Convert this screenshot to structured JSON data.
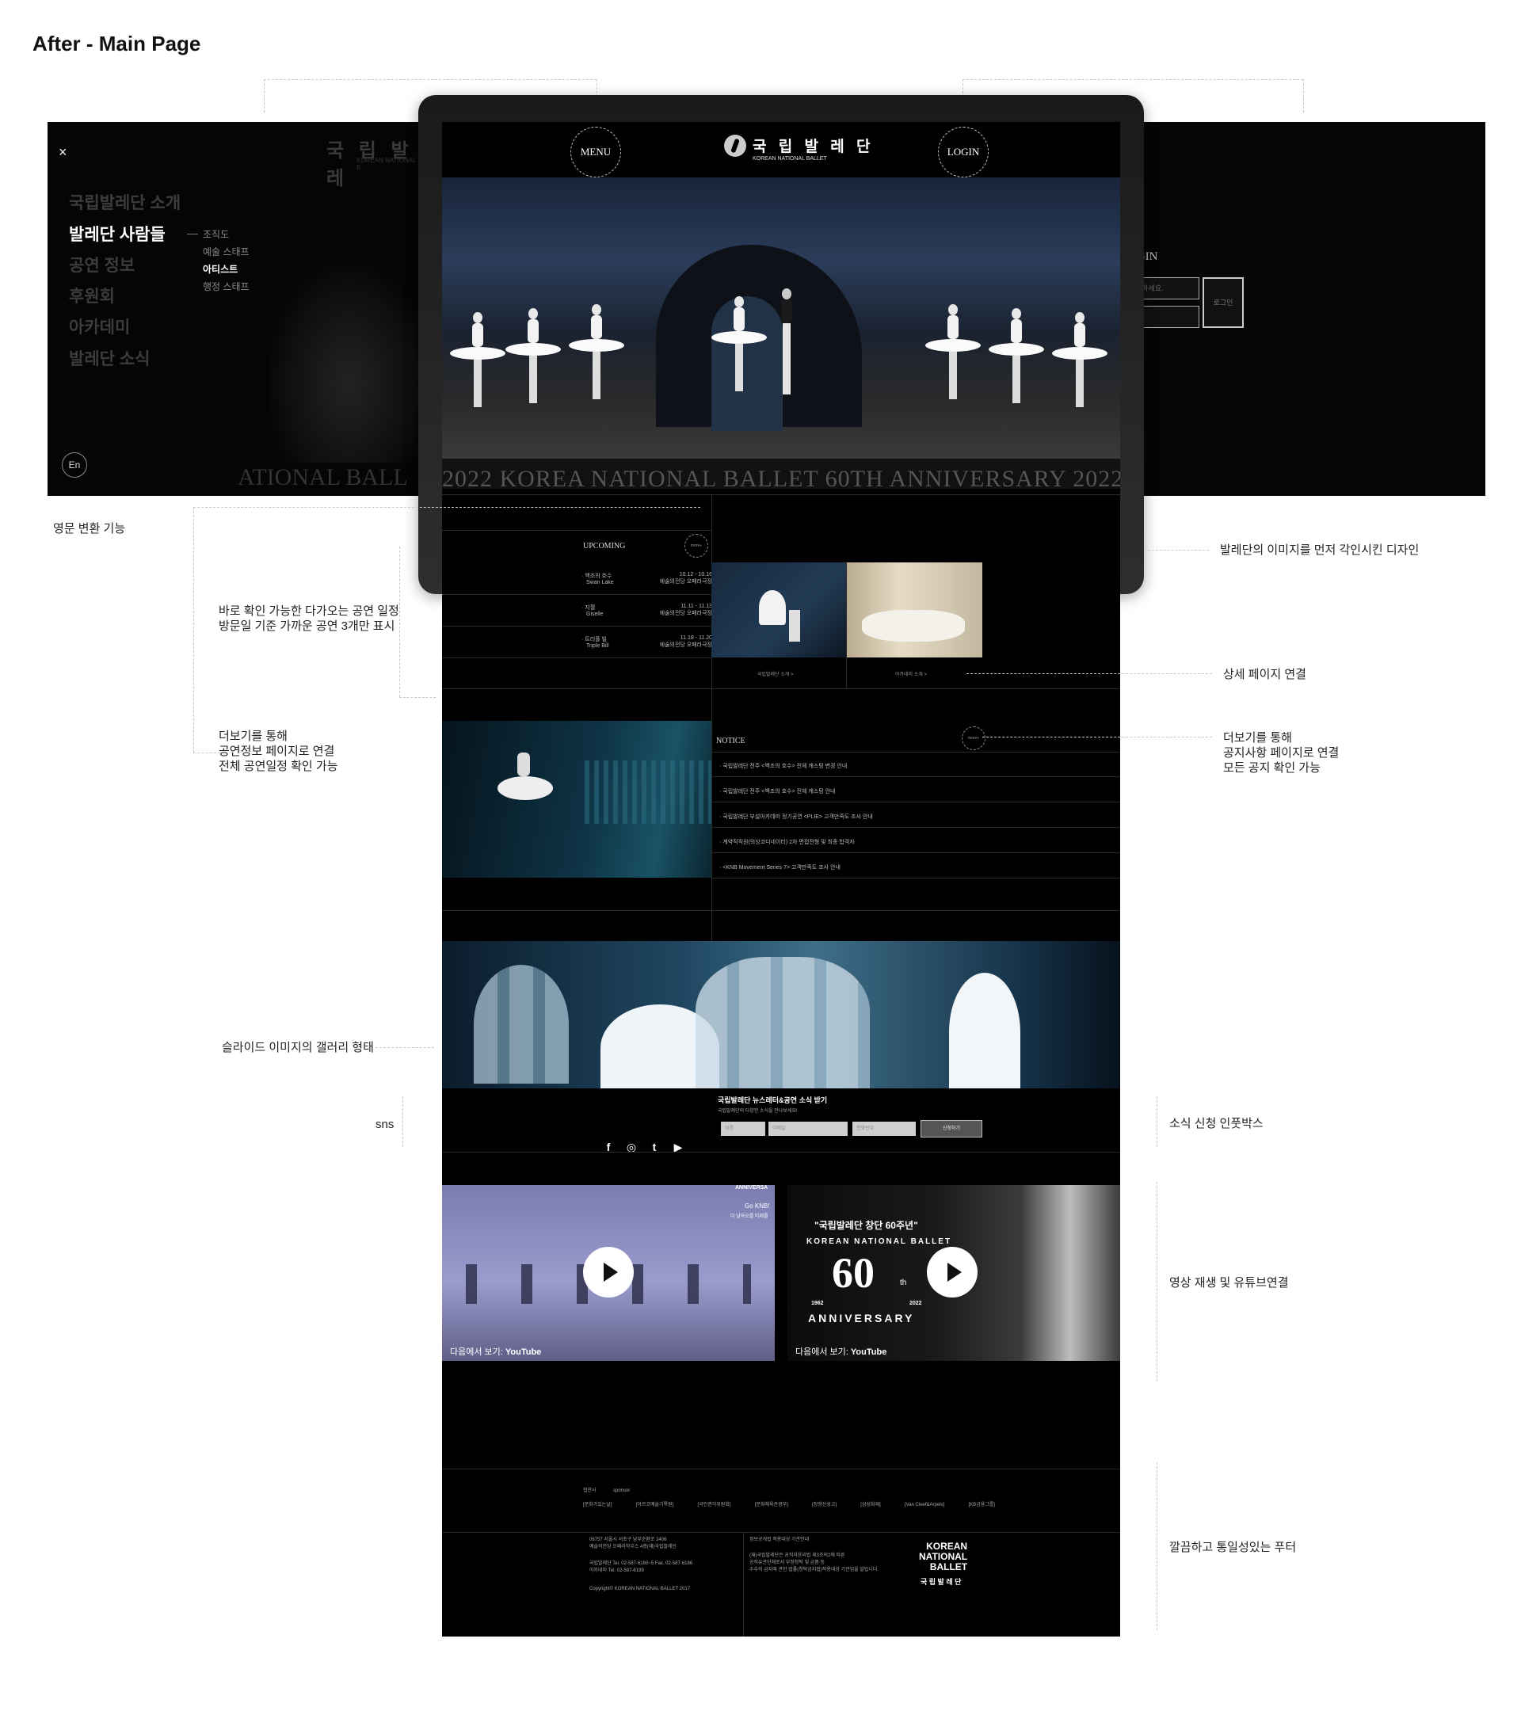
{
  "page_title": "After - Main Page",
  "annotations": {
    "lang_toggle": "영문 변환 기능",
    "upcoming": "바로 확인 가능한 다가오는 공연 일정\n방문일 기준 가까운 공연 3개만 표시",
    "more_upcoming": "더보기를 통해\n공연정보 페이지로 연결\n전체 공연일정 확인 가능",
    "gallery": "슬라이드 이미지의 갤러리 형태",
    "sns": "sns",
    "design": "발레단의 이미지를 먼저 각인시킨 디자인",
    "detail_link": "상세 페이지 연결",
    "more_notice": "더보기를 통해\n공지사항 페이지로 연결\n모든 공지 확인 가능",
    "newsletter": "소식 신청 인풋박스",
    "video": "영상 재생 및 유튜브연결",
    "footer": "깔끔하고 통일성있는 푸터"
  },
  "menu_panel": {
    "close": "×",
    "ghost_logo": "국 립 발 레",
    "ghost_logo_sub": "KOREAN NATIONAL B",
    "items": [
      "국립발레단 소개",
      "발레단 사람들",
      "공연 정보",
      "후원회",
      "아카데미",
      "발레단 소식"
    ],
    "active_index": 1,
    "submenu": [
      "조직도",
      "예술 스태프",
      "아티스트",
      "행정 스태프"
    ],
    "active_sub": 2,
    "lang": "En",
    "ghost_banner": "ATIONAL BALL"
  },
  "login_panel": {
    "title": "OGIN",
    "id_placeholder": "력하세요.",
    "pw_placeholder": "",
    "button": "로그인"
  },
  "site": {
    "menu_btn": "MENU",
    "login_btn": "LOGIN",
    "logo_ko": "국 립 발 레 단",
    "logo_en": "KOREAN NATIONAL BALLET",
    "anniversary": "2022 KOREA NATIONAL BALLET 60TH ANNIVERSARY 2022",
    "upcoming": {
      "title": "UPCOMING",
      "more": "more+",
      "items": [
        {
          "ko": "백조의 호수",
          "en": "Swan Lake",
          "date": "10.12 - 10.16",
          "venue": "예술의전당 오페라극장"
        },
        {
          "ko": "지젤",
          "en": "Giselle",
          "date": "11.11 - 11.13",
          "venue": "예술의전당 오페라극장"
        },
        {
          "ko": "트리플 빌",
          "en": "Triple Bill",
          "date": "11.18 - 11.20",
          "venue": "예술의전당 오페라극장"
        }
      ]
    },
    "photo_links": [
      "국립발레단 소개 >",
      "아카데미 소개 >"
    ],
    "notice": {
      "title": "NOTICE",
      "more": "more+",
      "items": [
        "국립발레단 전주 <백조의 호수> 전체 캐스팅 변경 안내",
        "국립발레단 전주 <백조의 호수> 전체 캐스팅 안내",
        "국립발레단 부설아카데미 정기공연 <PLIE> 고객만족도 조사 안내",
        "계약직직원(의상코디네이터) 2차 면접전형 및 최종 합격자",
        "<KNB Movement Series 7> 고객만족도 조사 안내"
      ]
    },
    "newsletter": {
      "title": "국립발레단 뉴스레터&공연 소식 받기",
      "subtitle": "국립발레단의 다양한 소식을 만나보세요!",
      "fields": [
        "이름",
        "이메일",
        "전화번호"
      ],
      "button": "신청하기"
    },
    "sns_icons": [
      "f",
      "◎",
      "t",
      "▶"
    ],
    "videos": [
      {
        "overlay_top": "ANNIVERSA",
        "overlay_mid": "Go KNB!",
        "overlay_bot": "더 날아오를 미래를",
        "watch_on": "다음에서 보기:",
        "yt": "YouTube"
      },
      {
        "title": "\"국립발레단 창단 60주년\"",
        "arc": "KOREAN NATIONAL BALLET",
        "big": "60",
        "th": "th",
        "years": [
          "1962",
          "2022"
        ],
        "anniv": "ANNIVERSARY",
        "watch_on": "다음에서 보기:",
        "yt": "YouTube"
      }
    ],
    "footer": {
      "host_label": "협찬사",
      "sponsor_label": "sponsor",
      "sponsors": [
        "[문화가있는날]",
        "[아르코예술기록원]",
        "[국민권익위원회]",
        "[문화체육관광부]",
        "[정형산성고]",
        "[삼성화재]",
        "[Van Cleef&Arpels]",
        "[KB금융그룹]"
      ],
      "address": "06757 서울시 서초구 남부순환로 2406\n예술의전당 오페라하우스 4층(재)국립발레단",
      "tel": "국립발레단      Tel. 02-587-6180~5 Fax. 02-587-6186\n아카데미          Tel. 02-587-6199",
      "copyright": "Copyright© KOREAN NATIONAL BALLET 2017",
      "public_title": "정보공개법 적용대상 기관안내",
      "public_text": "(재)국립발레단은 공직자윤리법 제3조의2에 따른\n공직유관단체로서 부정청탁 및 금품 등\n수수의 금지에 관한 법률(청탁금지법)적용대상 기관임을 알립니다.",
      "brand_en": "KOREAN\nNATIONAL\nBALLET",
      "brand_ko": "국 립 발 레 단"
    }
  }
}
